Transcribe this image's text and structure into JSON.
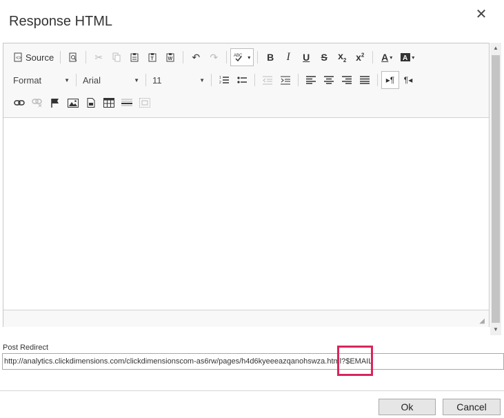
{
  "dialog": {
    "title": "Response HTML"
  },
  "toolbar": {
    "source_label": "Source",
    "format_label": "Format",
    "font_label": "Arial",
    "size_label": "11"
  },
  "post_redirect": {
    "label": "Post Redirect",
    "value": "http://analytics.clickdimensions.com/clickdimensionscom-as6rw/pages/h4d6kyeeeazqanohswza.html?$EMAIL"
  },
  "buttons": {
    "ok": "Ok",
    "cancel": "Cancel"
  },
  "colors": {
    "highlight": "#d9255c",
    "toolbar_bg": "#f8f8f8"
  }
}
